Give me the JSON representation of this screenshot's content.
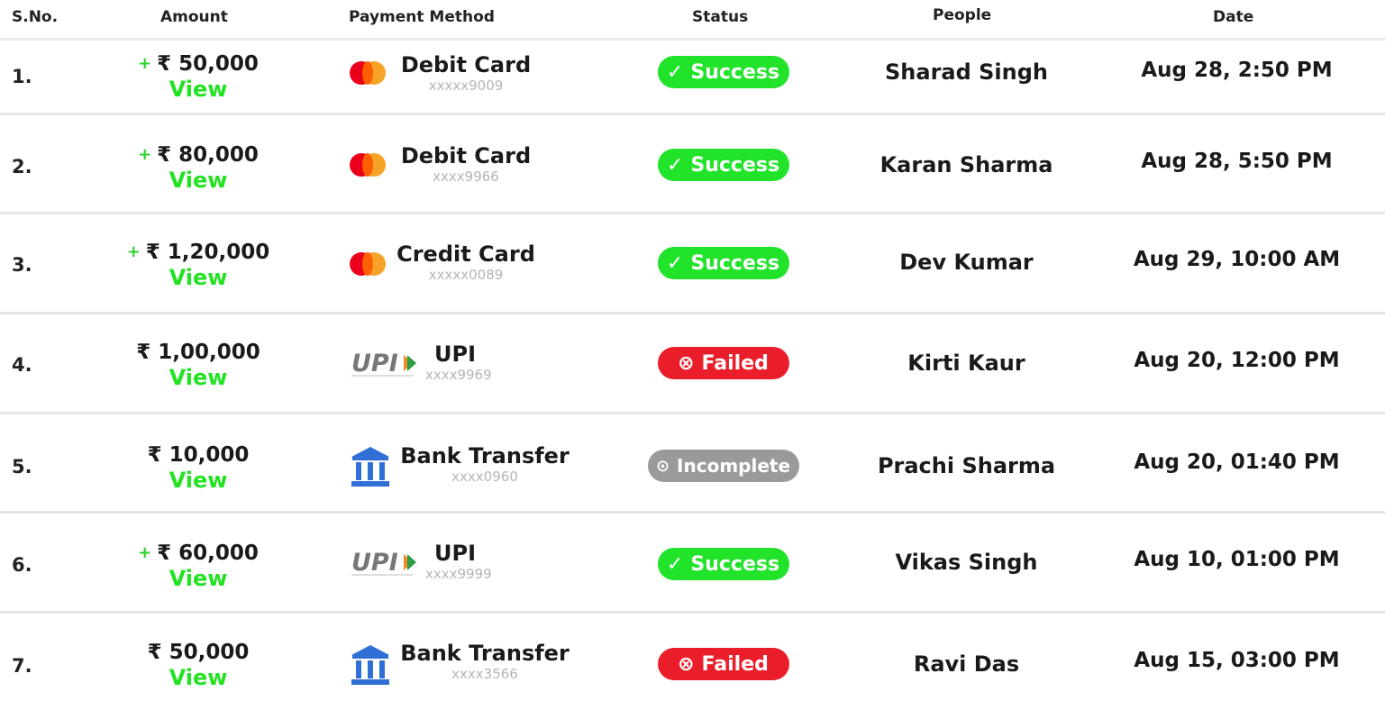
{
  "columns": {
    "sno": "S.No.",
    "amount": "Amount",
    "payment_method": "Payment Method",
    "status": "Status",
    "people": "People",
    "date": "Date"
  },
  "colors": {
    "success": "#21e42a",
    "failed": "#ea1e2a",
    "incomplete": "#9a9a9a",
    "view_link": "#22e222"
  },
  "rows": [
    {
      "sno": "1.",
      "plus": "+",
      "amount": "₹ 50,000",
      "view": "View",
      "method_icon": "mastercard-icon",
      "method": "Debit Card",
      "account": "xxxxx9009",
      "status": "Success",
      "status_icon": "check-icon",
      "person": "Sharad Singh",
      "date": "Aug 28, 2:50 PM"
    },
    {
      "sno": "2.",
      "plus": "+",
      "amount": "₹ 80,000",
      "view": "View",
      "method_icon": "mastercard-icon",
      "method": "Debit Card",
      "account": "xxxx9966",
      "status": "Success",
      "status_icon": "check-icon",
      "person": "Karan Sharma",
      "date": "Aug 28, 5:50 PM"
    },
    {
      "sno": "3.",
      "plus": "+",
      "amount": "₹ 1,20,000",
      "view": "View",
      "method_icon": "mastercard-icon",
      "method": "Credit Card",
      "account": "xxxxx0089",
      "status": "Success",
      "status_icon": "check-icon",
      "person": "Dev Kumar",
      "date": "Aug 29, 10:00 AM"
    },
    {
      "sno": "4.",
      "plus": "",
      "amount": "₹ 1,00,000",
      "view": "View",
      "method_icon": "upi-icon",
      "method": "UPI",
      "account": "xxxx9969",
      "status": "Failed",
      "status_icon": "x-circle-icon",
      "person": "Kirti Kaur",
      "date": "Aug 20, 12:00 PM"
    },
    {
      "sno": "5.",
      "plus": "",
      "amount": "₹ 10,000",
      "view": "View",
      "method_icon": "bank-icon",
      "method": "Bank Transfer",
      "account": "xxxx0960",
      "status": "Incomplete",
      "status_icon": "clock-circle-icon",
      "person": "Prachi Sharma",
      "date": "Aug 20, 01:40 PM"
    },
    {
      "sno": "6.",
      "plus": "+",
      "amount": "₹ 60,000",
      "view": "View",
      "method_icon": "upi-icon",
      "method": "UPI",
      "account": "xxxx9999",
      "status": "Success",
      "status_icon": "check-icon",
      "person": "Vikas Singh",
      "date": "Aug 10, 01:00 PM"
    },
    {
      "sno": "7.",
      "plus": "",
      "amount": "₹ 50,000",
      "view": "View",
      "method_icon": "bank-icon",
      "method": "Bank Transfer",
      "account": "xxxx3566",
      "status": "Failed",
      "status_icon": "x-circle-icon",
      "person": "Ravi Das",
      "date": "Aug 15, 03:00 PM"
    }
  ]
}
